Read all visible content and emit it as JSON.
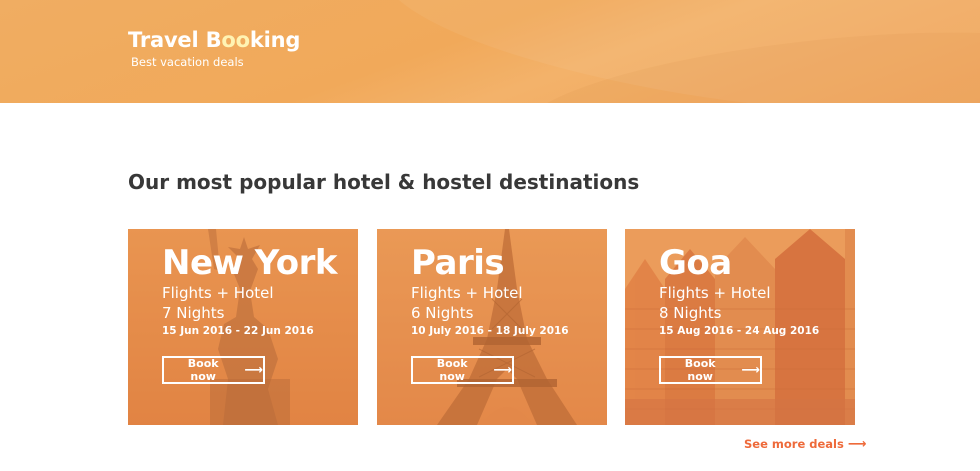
{
  "header": {
    "brand_prefix": "Travel B",
    "brand_highlight": "oo",
    "brand_suffix": "king",
    "tagline": "Best vacation deals"
  },
  "main": {
    "section_title": "Our most popular hotel & hostel destinations",
    "cards": [
      {
        "city": "New York",
        "package": "Flights + Hotel",
        "nights": "7 Nights",
        "dates": "15 Jun 2016 - 22 Jun 2016",
        "button": "Book now"
      },
      {
        "city": "Paris",
        "package": "Flights + Hotel",
        "nights": "6 Nights",
        "dates": "10 July 2016 - 18 July 2016",
        "button": "Book now"
      },
      {
        "city": "Goa",
        "package": "Flights + Hotel",
        "nights": "8 Nights",
        "dates": "15 Aug 2016 - 24 Aug 2016",
        "button": "Book now"
      }
    ],
    "see_more": "See more deals"
  },
  "colors": {
    "header_bg": "#f1aa5e",
    "accent": "#ee6a3a",
    "card_overlay": "#f08c3c"
  },
  "icons": [
    "arrow-right-icon"
  ]
}
